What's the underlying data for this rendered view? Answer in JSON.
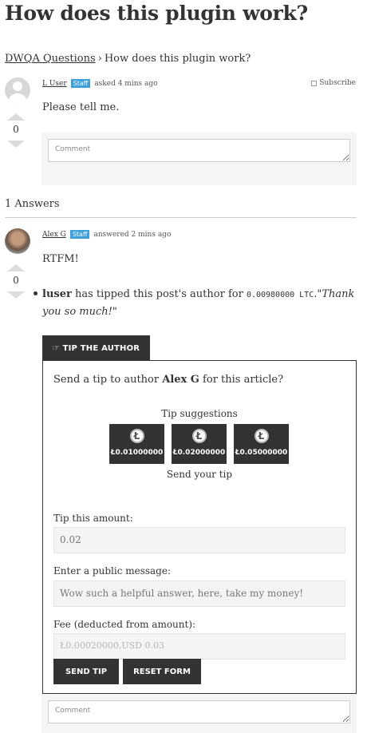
{
  "page": {
    "title": "How does this plugin work?"
  },
  "breadcrumb": {
    "root": "DWQA Questions",
    "separator": "›",
    "current": "How does this plugin work?"
  },
  "question": {
    "author": "L User",
    "badge": "Staff",
    "time": "asked 4 mins ago",
    "subscribe": "Subscribe",
    "votes": "0",
    "body": "Please tell me.",
    "comment_placeholder": "Comment"
  },
  "answers_header": "1 Answers",
  "answer": {
    "author": "Alex G",
    "badge": "Staff",
    "time": "answered 2 mins ago",
    "votes": "0",
    "body": "RTFM!",
    "comment_placeholder": "Comment"
  },
  "tip_note": {
    "tipper": "luser",
    "text_before": " has tipped this post's author for ",
    "amount": "0.00980000 LTC",
    "dot": ".",
    "quote": "\"Thank you so much!\""
  },
  "tip_widget": {
    "tab_label": "☞ TIP THE AUTHOR",
    "intro_before": "Send a tip to author ",
    "intro_author": "Alex G",
    "intro_after": " for this article?",
    "suggestions_title": "Tip suggestions",
    "suggestions": [
      {
        "amount": "Ł0.01000000",
        "icon": "litecoin-icon"
      },
      {
        "amount": "Ł0.02000000",
        "icon": "litecoin-icon"
      },
      {
        "amount": "Ł0.05000000",
        "icon": "litecoin-icon"
      }
    ],
    "send_note": "Send your tip",
    "amount_label": "Tip this amount:",
    "amount_value": "0.02",
    "message_label": "Enter a public message:",
    "message_value": "Wow such a helpful answer, here, take my money!",
    "fee_label": "Fee (deducted from amount):",
    "fee_value": "Ł0.00020000,USD 0.03",
    "send_button": "SEND TIP",
    "reset_button": "RESET FORM"
  },
  "colors": {
    "dark": "#333333",
    "badge": "#3f9fd8",
    "panel_bg": "#f5f5f5"
  }
}
